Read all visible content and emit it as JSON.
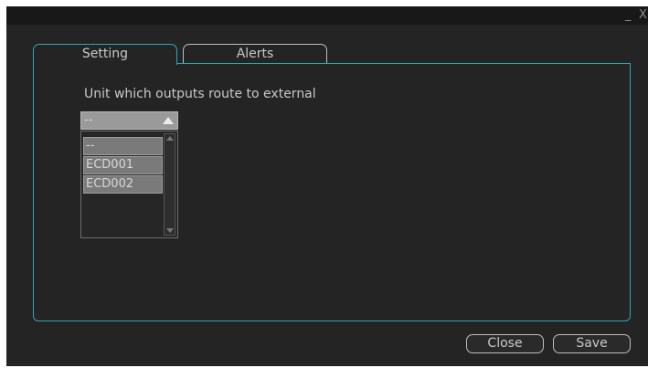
{
  "window": {
    "minimize_label": "_",
    "close_label": "X"
  },
  "tabs": [
    {
      "label": "Setting",
      "active": true
    },
    {
      "label": "Alerts",
      "active": false
    }
  ],
  "setting": {
    "route_output_label": "Unit which outputs route to external",
    "route_output_selected": "--",
    "route_output_options": [
      "--",
      "ECD001",
      "ECD002"
    ]
  },
  "footer": {
    "close_label": "Close",
    "save_label": "Save"
  },
  "colors": {
    "accent": "#2ea7b2",
    "background": "#242424",
    "text": "#c9c9c9"
  }
}
